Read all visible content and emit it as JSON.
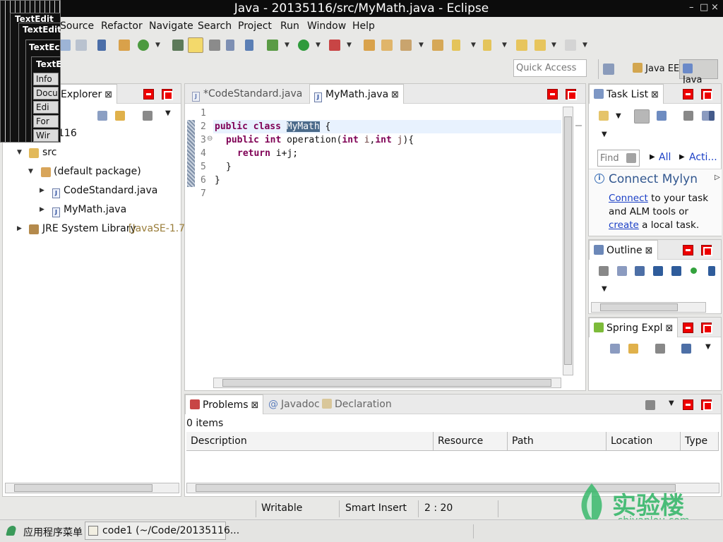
{
  "window": {
    "title": "Java - 20135116/src/MyMath.java - Eclipse",
    "controls": [
      "–",
      "□",
      "×"
    ]
  },
  "menu": [
    "Source",
    "Refactor",
    "Navigate",
    "Search",
    "Project",
    "Run",
    "Window",
    "Help"
  ],
  "quick_access": {
    "placeholder": "Quick Access"
  },
  "perspectives": [
    {
      "label": "Java EE",
      "active": false
    },
    {
      "label": "Java",
      "active": true
    }
  ],
  "package_explorer": {
    "tab_label": "Explorer",
    "project_label": "116",
    "tree": [
      {
        "label": "src"
      },
      {
        "label": "(default package)"
      },
      {
        "label": "CodeStandard.java"
      },
      {
        "label": "MyMath.java"
      },
      {
        "label": "JRE System Library",
        "suffix": "[JavaSE-1.7]"
      }
    ]
  },
  "editor": {
    "tabs": [
      {
        "label": "*CodeStandard.java",
        "active": false
      },
      {
        "label": "MyMath.java",
        "active": true
      }
    ],
    "line_numbers": [
      "1",
      "2",
      "3",
      "4",
      "5",
      "6",
      "7"
    ],
    "code": {
      "l2_kw": "public class ",
      "l2_sel": "MyMath",
      "l2_rest": " {",
      "l3_kw1": "public int ",
      "l3_a": "operation(",
      "l3_kw2": "int ",
      "l3_v1": "i",
      "l3_b": ",",
      "l3_kw3": "int ",
      "l3_v2": "j",
      "l3_c": "){",
      "l4_kw": "return ",
      "l4_rest": "i+j;",
      "l5": "}",
      "l6": "}"
    }
  },
  "task_list": {
    "tab_label": "Task List",
    "find_placeholder": "Find",
    "filter_all": "All",
    "filter_acti": "Acti...",
    "mylyn_title": "Connect Mylyn",
    "mylyn_connect": "Connect",
    "mylyn_text1": " to your task and ALM tools or ",
    "mylyn_create": "create",
    "mylyn_text2": " a local task."
  },
  "outline": {
    "tab_label": "Outline"
  },
  "spring": {
    "tab_label": "Spring Expl"
  },
  "problems": {
    "tabs": [
      "Problems",
      "Javadoc",
      "Declaration"
    ],
    "count": "0 items",
    "columns": [
      "Description",
      "Resource",
      "Path",
      "Location",
      "Type"
    ]
  },
  "statusbar": {
    "writable": "Writable",
    "insert_mode": "Smart Insert",
    "position": "2 : 20"
  },
  "taskbar": {
    "app_menu": "应用程序菜单",
    "window_item": "code1 (~/Code/20135116..."
  },
  "watermark": {
    "brand_cn": "实验楼",
    "brand_url": "shiyanlou.com"
  },
  "overlay_windows": {
    "title": "TextEdit",
    "title_short": "TextEc",
    "items": [
      "Info",
      "Docu",
      "Edi",
      "For",
      "Wir"
    ]
  },
  "colors": {
    "keyword": "#7f0055",
    "variable": "#6a3e3e",
    "selection": "#4a6a8a",
    "view_button": "#ee0000",
    "link": "#1a3fc6"
  }
}
